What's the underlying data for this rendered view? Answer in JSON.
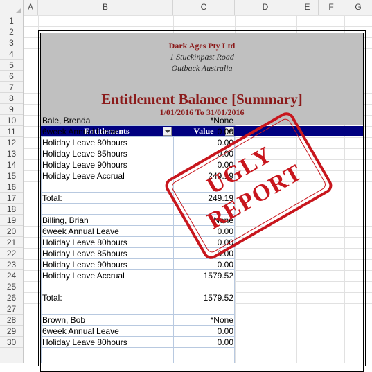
{
  "columns": [
    "A",
    "B",
    "C",
    "D",
    "E",
    "F",
    "G"
  ],
  "rows": [
    "1",
    "2",
    "3",
    "4",
    "5",
    "6",
    "7",
    "8",
    "9",
    "10",
    "11",
    "12",
    "13",
    "14",
    "15",
    "16",
    "17",
    "18",
    "19",
    "20",
    "21",
    "22",
    "23",
    "24",
    "25",
    "26",
    "27",
    "28",
    "29",
    "30"
  ],
  "report": {
    "company": "Dark Ages Pty Ltd",
    "address1": "1 Stuckinpast Road",
    "address2": "Outback Australia",
    "title": "Entitlement Balance [Summary]",
    "dates": "1/01/2016 To 31/01/2016",
    "col_entitlements": "Entitlements",
    "col_value": "Value"
  },
  "stamp": {
    "line1": "UGLY",
    "line2": "REPORT"
  },
  "lines": [
    {
      "ent": "Bale, Brenda",
      "val": "*None"
    },
    {
      "ent": "6week Annual Leave",
      "val": "0.00"
    },
    {
      "ent": "Holiday Leave 80hours",
      "val": "0.00"
    },
    {
      "ent": "Holiday Leave 85hours",
      "val": "0.00"
    },
    {
      "ent": "Holiday Leave 90hours",
      "val": "0.00"
    },
    {
      "ent": "Holiday Leave Accrual",
      "val": "249.19"
    },
    {
      "ent": "",
      "val": ""
    },
    {
      "ent": "Total:",
      "val": "249.19"
    },
    {
      "ent": "",
      "val": ""
    },
    {
      "ent": "Billing, Brian",
      "val": "*None"
    },
    {
      "ent": "6week Annual Leave",
      "val": "0.00"
    },
    {
      "ent": "Holiday Leave 80hours",
      "val": "0.00"
    },
    {
      "ent": "Holiday Leave 85hours",
      "val": "0.00"
    },
    {
      "ent": "Holiday Leave 90hours",
      "val": "0.00"
    },
    {
      "ent": "Holiday Leave Accrual",
      "val": "1579.52"
    },
    {
      "ent": "",
      "val": ""
    },
    {
      "ent": "Total:",
      "val": "1579.52"
    },
    {
      "ent": "",
      "val": ""
    },
    {
      "ent": "Brown, Bob",
      "val": "*None"
    },
    {
      "ent": "6week Annual Leave",
      "val": "0.00"
    },
    {
      "ent": "Holiday Leave 80hours",
      "val": "0.00"
    }
  ],
  "colors": {
    "header_bg": "#c0c0c0",
    "title_red": "#8b1a1a",
    "bar_blue": "#000080",
    "stamp_red": "#c8161d"
  }
}
